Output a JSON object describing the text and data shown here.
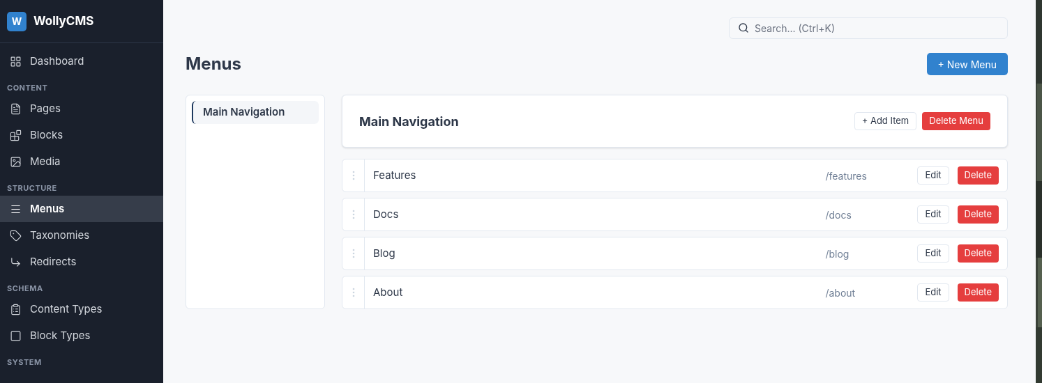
{
  "app": {
    "logo_letter": "W",
    "name": "WollyCMS"
  },
  "sidebar": {
    "sections": [
      {
        "items": [
          {
            "label": "Dashboard",
            "selected": false
          }
        ]
      },
      {
        "heading": "CONTENT",
        "items": [
          {
            "label": "Pages",
            "selected": false
          },
          {
            "label": "Blocks",
            "selected": false
          },
          {
            "label": "Media",
            "selected": false
          }
        ]
      },
      {
        "heading": "STRUCTURE",
        "items": [
          {
            "label": "Menus",
            "selected": true
          },
          {
            "label": "Taxonomies",
            "selected": false
          },
          {
            "label": "Redirects",
            "selected": false
          }
        ]
      },
      {
        "heading": "SCHEMA",
        "items": [
          {
            "label": "Content Types",
            "selected": false
          },
          {
            "label": "Block Types",
            "selected": false
          }
        ]
      },
      {
        "heading": "SYSTEM"
      }
    ]
  },
  "search": {
    "placeholder": "Search... (Ctrl+K)"
  },
  "page_title": "Menus",
  "new_button": "+ New Menu",
  "menu_list": [
    {
      "label": "Main Navigation",
      "selected": true
    }
  ],
  "menu_detail": {
    "title": "Main Navigation",
    "add_button": "+ Add Item",
    "delete_button": "Delete Menu",
    "items": [
      {
        "label": "Features",
        "url": "/features",
        "edit": "Edit",
        "delete": "Delete"
      },
      {
        "label": "Docs",
        "url": "/docs",
        "edit": "Edit",
        "delete": "Delete"
      },
      {
        "label": "Blog",
        "url": "/blog",
        "edit": "Edit",
        "delete": "Delete"
      },
      {
        "label": "About",
        "url": "/about",
        "edit": "Edit",
        "delete": "Delete"
      }
    ]
  }
}
